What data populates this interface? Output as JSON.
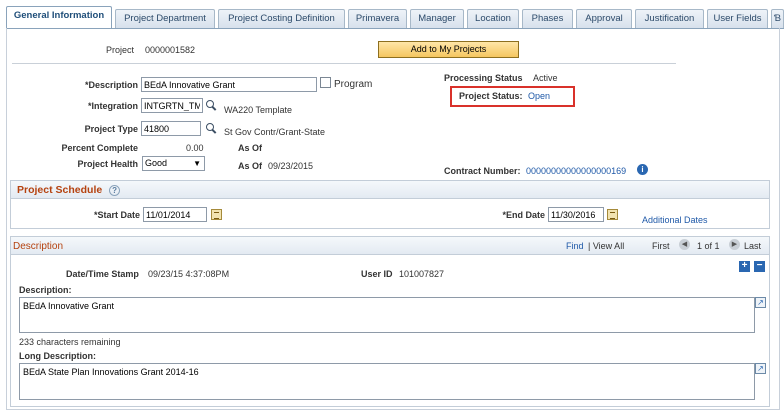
{
  "tabs": [
    {
      "label": "General Information",
      "active": true
    },
    {
      "label": "Project Department"
    },
    {
      "label": "Project Costing Definition"
    },
    {
      "label": "Primavera"
    },
    {
      "label": "Manager"
    },
    {
      "label": "Location"
    },
    {
      "label": "Phases"
    },
    {
      "label": "Approval"
    },
    {
      "label": "Justification"
    },
    {
      "label": "User Fields"
    }
  ],
  "project": {
    "label": "Project",
    "value": "0000001582"
  },
  "add_to_projects_button": "Add to My Projects",
  "description": {
    "label": "*Description",
    "value": "BEdA Innovative Grant"
  },
  "program_checkbox": {
    "label": "Program",
    "checked": false
  },
  "processing_status": {
    "label": "Processing Status",
    "value": "Active"
  },
  "project_status": {
    "label": "Project Status:",
    "value": "Open"
  },
  "integration": {
    "label": "*Integration",
    "value": "INTGRTN_TM",
    "description": "WA220 Template"
  },
  "project_type": {
    "label": "Project Type",
    "value": "41800",
    "description": "St Gov Contr/Grant-State"
  },
  "percent_complete": {
    "label": "Percent Complete",
    "value": "0.00",
    "as_of_label": "As Of"
  },
  "project_health": {
    "label": "Project Health",
    "value": "Good",
    "as_of_label": "As Of",
    "as_of_value": "09/23/2015"
  },
  "contract_number": {
    "label": "Contract Number:",
    "value": "00000000000000000169"
  },
  "schedule": {
    "title": "Project Schedule",
    "start_date_label": "*Start Date",
    "start_date": "11/01/2014",
    "end_date_label": "*End Date",
    "end_date": "11/30/2016",
    "additional_dates": "Additional Dates"
  },
  "description_section": {
    "title": "Description",
    "find": "Find",
    "view_all": "| View All",
    "first": "First",
    "range": "1 of 1",
    "last": "Last",
    "timestamp_label": "Date/Time Stamp",
    "timestamp_value": "09/23/15  4:37:08PM",
    "user_id_label": "User ID",
    "user_id_value": "101007827",
    "description_label": "Description:",
    "description_value": "BEdA Innovative Grant",
    "chars_remaining": "233 characters remaining",
    "long_description_label": "Long Description:",
    "long_description_value": "BEdA State Plan Innovations Grant 2014-16"
  },
  "colors": {
    "accent": "#b5420f",
    "link": "#1f59a8",
    "highlight_box": "#d9312a"
  }
}
